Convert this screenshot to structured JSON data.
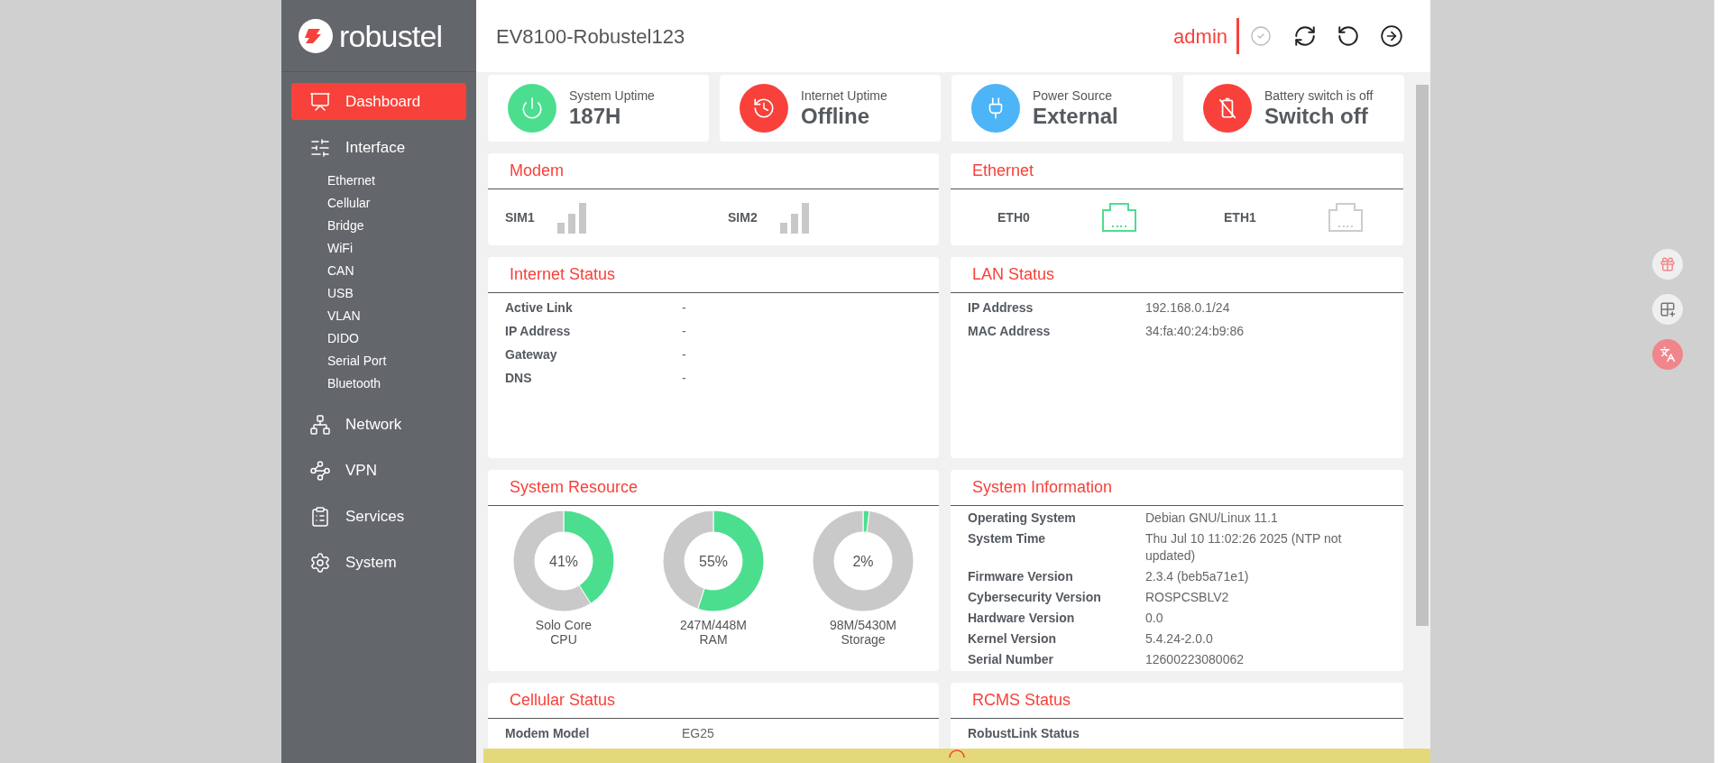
{
  "header": {
    "logo": "robustel",
    "title": "EV8100-Robustel123",
    "user": "admin"
  },
  "sidebar": {
    "items": [
      {
        "label": "Dashboard",
        "selected": true
      },
      {
        "label": "Interface",
        "selected": false,
        "children": [
          {
            "label": "Ethernet"
          },
          {
            "label": "Cellular"
          },
          {
            "label": "Bridge"
          },
          {
            "label": "WiFi"
          },
          {
            "label": "CAN"
          },
          {
            "label": "USB"
          },
          {
            "label": "VLAN"
          },
          {
            "label": "DIDO"
          },
          {
            "label": "Serial Port"
          },
          {
            "label": "Bluetooth"
          }
        ]
      },
      {
        "label": "Network",
        "selected": false
      },
      {
        "label": "VPN",
        "selected": false
      },
      {
        "label": "Services",
        "selected": false
      },
      {
        "label": "System",
        "selected": false
      }
    ]
  },
  "summary_cards": [
    {
      "label": "System Uptime",
      "value": "187H",
      "color": "#4cde8f"
    },
    {
      "label": "Internet Uptime",
      "value": "Offline",
      "color": "#f8413a"
    },
    {
      "label": "Power Source",
      "value": "External",
      "color": "#4db4f7"
    },
    {
      "label": "Battery switch is off",
      "value": "Switch off",
      "color": "#f8413a"
    }
  ],
  "modem": {
    "title": "Modem",
    "sims": [
      {
        "label": "SIM1"
      },
      {
        "label": "SIM2"
      }
    ]
  },
  "ethernet": {
    "title": "Ethernet",
    "ports": [
      {
        "label": "ETH0",
        "connected": true
      },
      {
        "label": "ETH1",
        "connected": false
      }
    ]
  },
  "internet_status": {
    "title": "Internet Status",
    "rows": [
      {
        "label": "Active Link",
        "value": "-"
      },
      {
        "label": "IP Address",
        "value": "-"
      },
      {
        "label": "Gateway",
        "value": "-"
      },
      {
        "label": "DNS",
        "value": "-"
      }
    ]
  },
  "lan_status": {
    "title": "LAN Status",
    "rows": [
      {
        "label": "IP Address",
        "value": "192.168.0.1/24"
      },
      {
        "label": "MAC Address",
        "value": "34:fa:40:24:b9:86"
      }
    ]
  },
  "system_resource": {
    "title": "System Resource",
    "gauges": [
      {
        "percent": "41%",
        "detail": "Solo Core",
        "name": "CPU",
        "chart_data": {
          "type": "donut",
          "values": [
            41,
            59
          ]
        }
      },
      {
        "percent": "55%",
        "detail": "247M/448M",
        "name": "RAM",
        "chart_data": {
          "type": "donut",
          "values": [
            55,
            45
          ]
        }
      },
      {
        "percent": "2%",
        "detail": "98M/5430M",
        "name": "Storage",
        "chart_data": {
          "type": "donut",
          "values": [
            2,
            98
          ]
        }
      }
    ]
  },
  "system_information": {
    "title": "System Information",
    "rows": [
      {
        "label": "Operating System",
        "value": "Debian GNU/Linux 11.1"
      },
      {
        "label": "System Time",
        "value": "Thu Jul 10 11:02:26 2025 (NTP not updated)"
      },
      {
        "label": "Firmware Version",
        "value": "2.3.4 (beb5a71e1)"
      },
      {
        "label": "Cybersecurity Version",
        "value": "ROSPCSBLV2"
      },
      {
        "label": "Hardware Version",
        "value": "0.0"
      },
      {
        "label": "Kernel Version",
        "value": "5.4.24-2.0.0"
      },
      {
        "label": "Serial Number",
        "value": "12600223080062"
      }
    ]
  },
  "cellular_status": {
    "title": "Cellular Status",
    "rows": [
      {
        "label": "Modem Model",
        "value": "EG25"
      }
    ]
  },
  "rcms_status": {
    "title": "RCMS Status",
    "rows": [
      {
        "label": "RobustLink Status"
      }
    ]
  }
}
